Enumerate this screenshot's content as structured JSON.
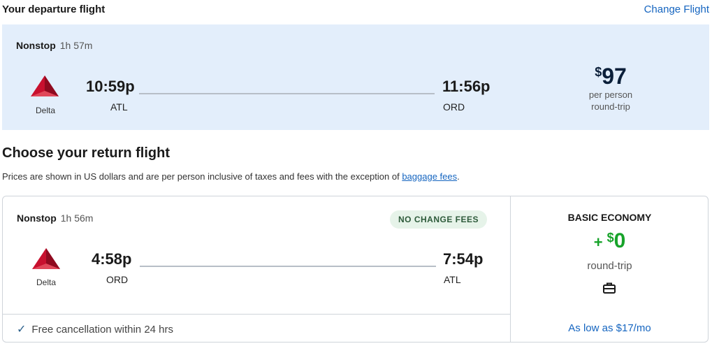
{
  "departure": {
    "heading": "Your departure flight",
    "change_link": "Change Flight",
    "stops": "Nonstop",
    "duration": "1h 57m",
    "airline": "Delta",
    "depart_time": "10:59p",
    "depart_code": "ATL",
    "arrive_time": "11:56p",
    "arrive_code": "ORD",
    "price_symbol": "$",
    "price": "97",
    "price_line1": "per person",
    "price_line2": "round-trip"
  },
  "return_section": {
    "heading": "Choose your return flight",
    "note_text": "Prices are shown in US dollars and are per person inclusive of taxes and fees with the exception of ",
    "note_link": "baggage fees",
    "note_end": "."
  },
  "return_flight": {
    "stops": "Nonstop",
    "duration": "1h 56m",
    "badge": "NO CHANGE FEES",
    "airline": "Delta",
    "depart_time": "4:58p",
    "depart_code": "ORD",
    "arrive_time": "7:54p",
    "arrive_code": "ATL",
    "free_cancel": "Free cancellation within 24 hrs",
    "check_icon": "check-icon"
  },
  "fare": {
    "name": "BASIC ECONOMY",
    "plus": "+",
    "symbol": "$",
    "amount": "0",
    "sub": "round-trip",
    "icon": "briefcase-icon",
    "low_price_link": "As low as $17/mo"
  },
  "colors": {
    "accent": "#1565c0",
    "departure_bg": "#e3eefb",
    "fare_green": "#17a32a",
    "delta_red": "#c8102e"
  }
}
